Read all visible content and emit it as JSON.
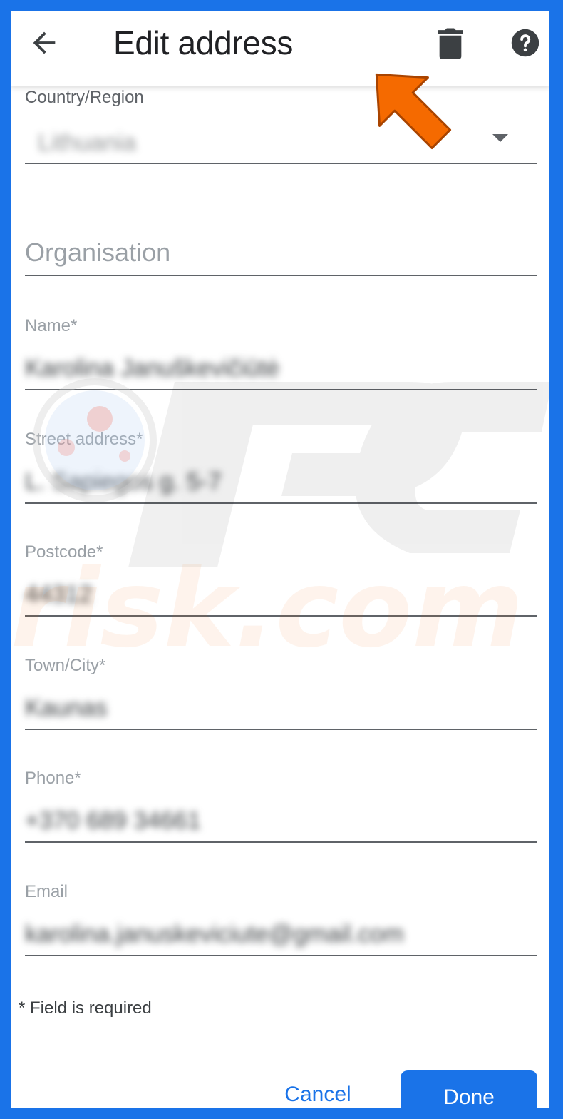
{
  "header": {
    "title": "Edit address",
    "back_icon": "arrow-back-icon",
    "delete_icon": "trash-icon",
    "help_icon": "help-icon"
  },
  "form": {
    "country": {
      "label": "Country/Region",
      "value": "Lithuania"
    },
    "organisation": {
      "placeholder": "Organisation"
    },
    "name": {
      "label": "Name*",
      "value": "Karolina Januškevičiūtė"
    },
    "street": {
      "label": "Street address*",
      "value": "L. Sapiegos g. 5-7"
    },
    "postcode": {
      "label": "Postcode*",
      "value": "44312"
    },
    "city": {
      "label": "Town/City*",
      "value": "Kaunas"
    },
    "phone": {
      "label": "Phone*",
      "value": "+370 689 34661"
    },
    "email": {
      "label": "Email",
      "value": "karolina.januskeviciute@gmail.com"
    }
  },
  "required_note": "* Field is required",
  "actions": {
    "cancel": "Cancel",
    "done": "Done"
  },
  "colors": {
    "accent": "#1a73e8",
    "annotation_arrow": "#f56a00"
  }
}
